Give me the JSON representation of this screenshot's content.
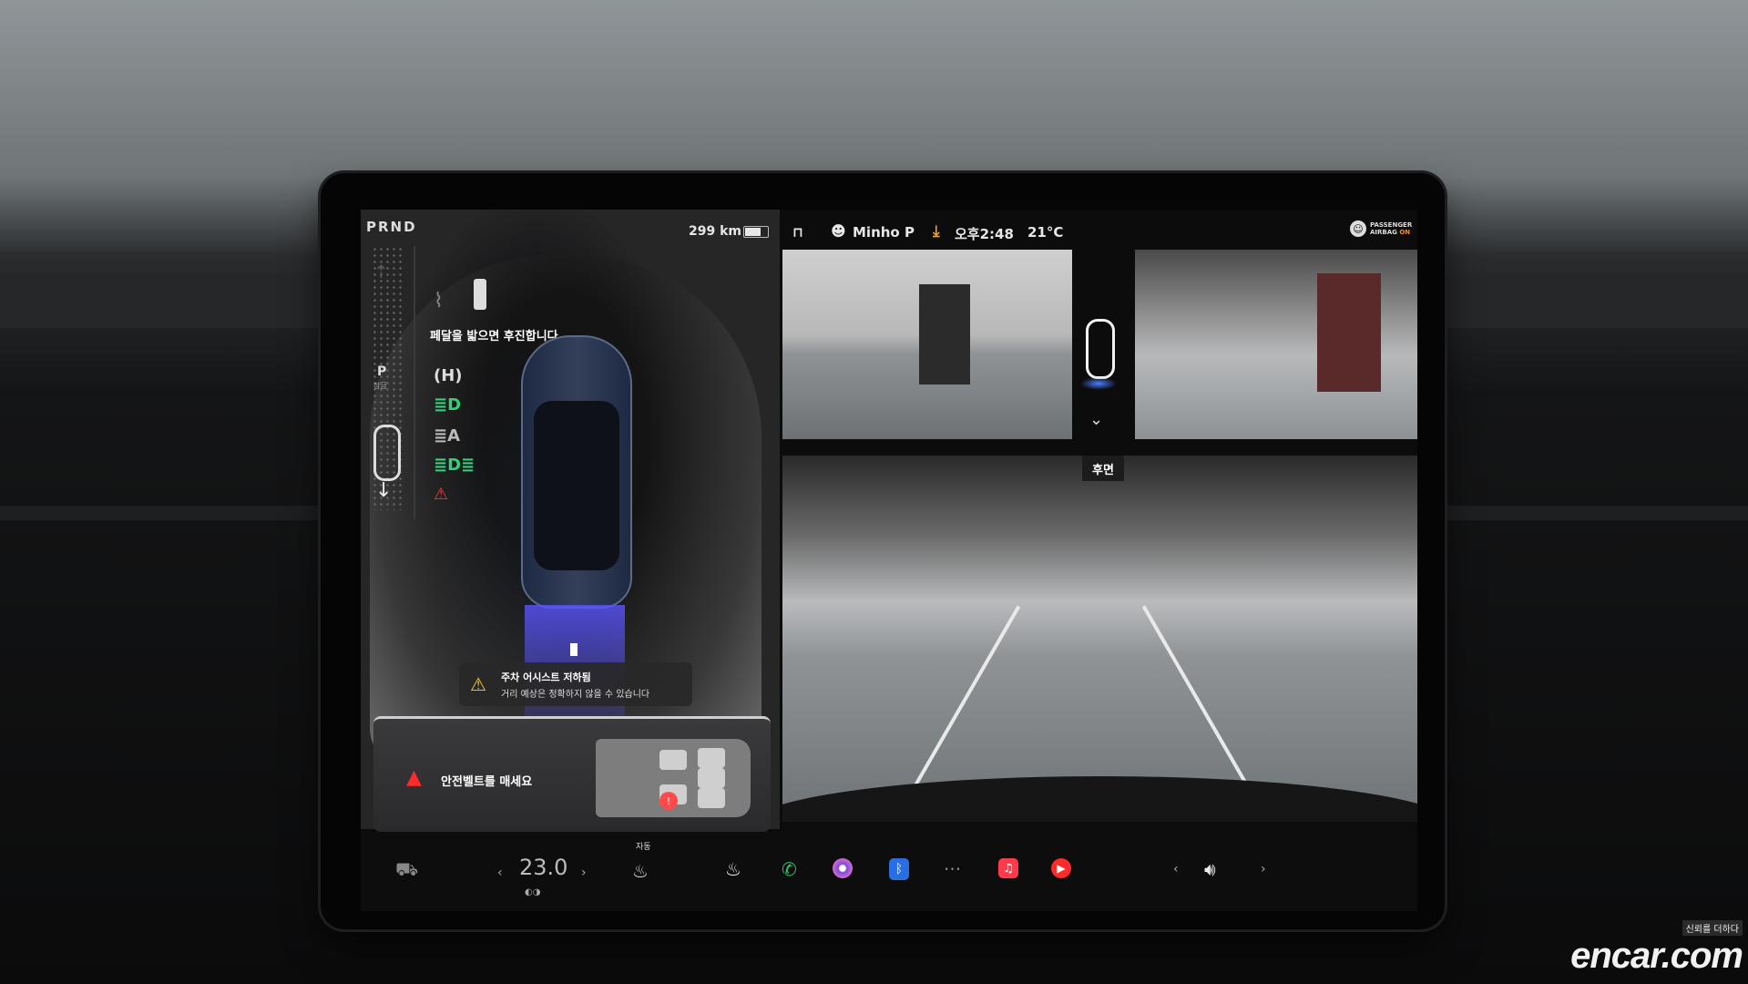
{
  "status": {
    "gear_letters": "PRND",
    "range": "299 km",
    "battery_level": 0.65,
    "user": "Minho P",
    "time": "오후2:48",
    "outside_temp": "21°C",
    "airbag_line1": "PASSENGER",
    "airbag_line2": "AIRBAG",
    "airbag_state": "ON"
  },
  "drive": {
    "gear_p": "P",
    "gear_p_sub": "잠금"
  },
  "left": {
    "hint": "페달을 밟으면 후진합니다",
    "assist_title": "주차 어시스트 저하됨",
    "assist_body": "거리 예상은 정확하지 않을 수 있습니다",
    "belt_message": "안전벨트를 매세요"
  },
  "camera": {
    "rear_label": "후면"
  },
  "dock": {
    "temp_left_arrow": "‹",
    "temperature": "23.0",
    "temp_right_arrow": "›",
    "seat_heat_mode": "자동",
    "more": "···",
    "vol_left": "‹",
    "vol_right": "›"
  },
  "watermark": {
    "tagline": "신뢰를 더하다",
    "brand": "encar.com"
  },
  "colors": {
    "warning_yellow": "#ffcc2a",
    "alert_red": "#ff2a2a",
    "light_green": "#33d17a",
    "download_orange": "#f0a020",
    "bluetooth_blue": "#2a6ee6"
  },
  "icons": [
    "lock-icon",
    "user-icon",
    "download-icon",
    "airbag-icon",
    "wiper-icon",
    "washer-fluid-icon",
    "parking-brake-icon",
    "headlight-icon",
    "auto-high-beam-icon",
    "parking-light-icon",
    "seatbelt-warning-icon",
    "warning-icon",
    "chevron-down-icon",
    "car-icon",
    "seat-heat-icon",
    "heater-icon",
    "phone-icon",
    "camera-icon",
    "bluetooth-icon",
    "more-icon",
    "music-icon",
    "media-icon",
    "volume-icon"
  ]
}
